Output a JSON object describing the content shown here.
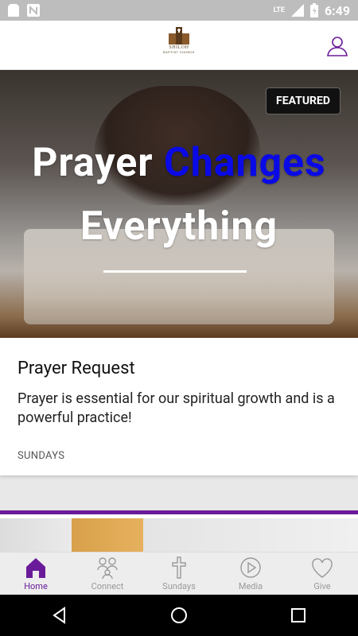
{
  "status_bar": {
    "time": "6:49",
    "network": "LTE",
    "icons": [
      "sd-card-icon",
      "n-notification-icon",
      "signal-icon",
      "battery-icon"
    ]
  },
  "header": {
    "logo_title": "SHILOH",
    "logo_subtitle": "BAPTIST CHURCH",
    "profile_icon": "profile-icon"
  },
  "featured_card": {
    "badge": "FEATURED",
    "hero_line1_word1": "Prayer",
    "hero_line1_word2": "Changes",
    "hero_line2": "Everything",
    "title": "Prayer Request",
    "description": "Prayer is essential for our spiritual growth and is a powerful practice!",
    "meta": "SUNDAYS",
    "accent_color": "#0a0ae6"
  },
  "next_card": {
    "accent_color": "#6a1b9a"
  },
  "bottom_nav": {
    "items": [
      {
        "label": "Home",
        "icon": "home-icon",
        "active": true
      },
      {
        "label": "Connect",
        "icon": "people-icon",
        "active": false
      },
      {
        "label": "Sundays",
        "icon": "cross-icon",
        "active": false
      },
      {
        "label": "Media",
        "icon": "play-icon",
        "active": false
      },
      {
        "label": "Give",
        "icon": "heart-icon",
        "active": false
      }
    ]
  },
  "system_nav": {
    "back": "back-icon",
    "home": "home-circle-icon",
    "recents": "recents-icon"
  },
  "colors": {
    "brand_purple": "#6a1b9a",
    "inactive_gray": "#999999"
  }
}
